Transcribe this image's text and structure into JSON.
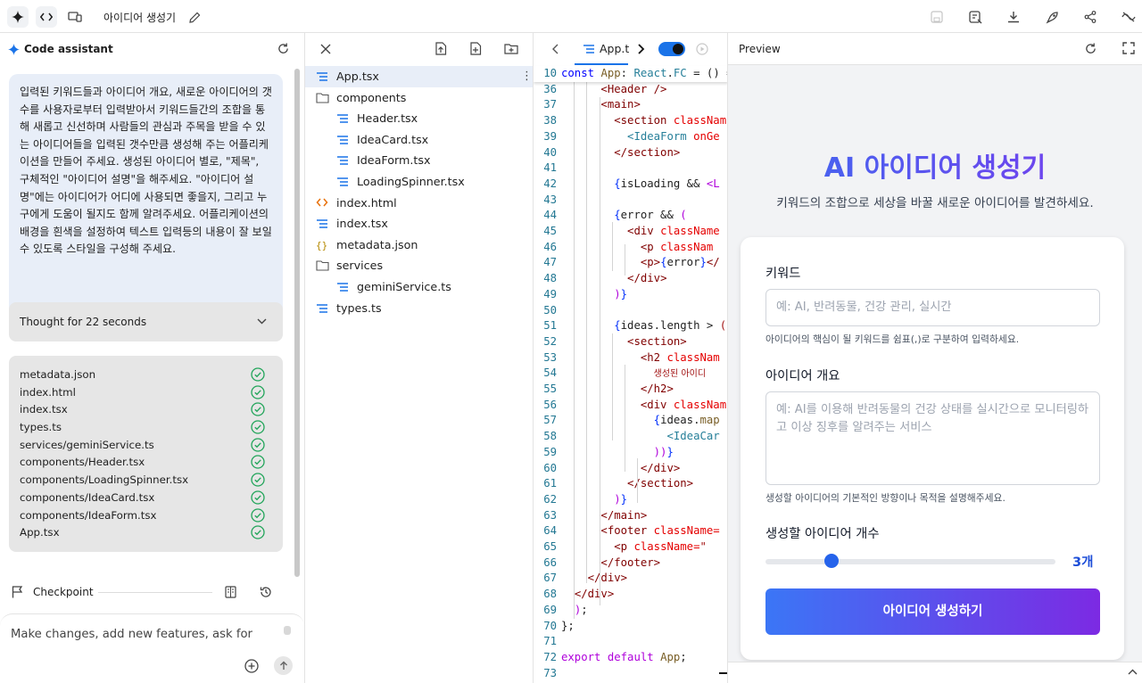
{
  "topbar": {
    "project_title": "아이디어 생성기"
  },
  "chat": {
    "title": "Code assistant",
    "prompt": "입력된 키워드들과 아이디어 개요, 새로운 아이디어의 갯수를 사용자로부터 입력받아서 키워드들간의 조합을 통해 새롭고 신선하며 사람들의 관심과 주목을 받을 수 있는 아이디어들을 입력된 갯수만큼 생성해 주는 어플리케이션을 만들어 주세요. 생성된 아이디어 별로, \"제목\", 구체적인 \"아이디어 설명\"을 해주세요. \"아이디어 설명\"에는 아이디어가 어디에 사용되면 좋을지, 그리고 누구에게 도움이 될지도 함께 알려주세요. 어플리케이션의 배경을 흰색을 설정하여 텍스트 입력등의 내용이 잘 보일 수 있도록 스타일을 구성해 주세요.",
    "thought": "Thought for 22 seconds",
    "files": [
      "metadata.json",
      "index.html",
      "index.tsx",
      "types.ts",
      "services/geminiService.ts",
      "components/Header.tsx",
      "components/LoadingSpinner.tsx",
      "components/IdeaCard.tsx",
      "components/IdeaForm.tsx",
      "App.tsx"
    ],
    "checkpoint": "Checkpoint",
    "input_placeholder": "Make changes, add new features, ask for"
  },
  "tree": {
    "items": [
      {
        "name": "App.tsx",
        "kind": "tsx",
        "indent": 0,
        "selected": true
      },
      {
        "name": "components",
        "kind": "folder",
        "indent": 0
      },
      {
        "name": "Header.tsx",
        "kind": "tsx",
        "indent": 1
      },
      {
        "name": "IdeaCard.tsx",
        "kind": "tsx",
        "indent": 1
      },
      {
        "name": "IdeaForm.tsx",
        "kind": "tsx",
        "indent": 1
      },
      {
        "name": "LoadingSpinner.tsx",
        "kind": "tsx",
        "indent": 1
      },
      {
        "name": "index.html",
        "kind": "html",
        "indent": 0
      },
      {
        "name": "index.tsx",
        "kind": "tsx",
        "indent": 0
      },
      {
        "name": "metadata.json",
        "kind": "json",
        "indent": 0
      },
      {
        "name": "services",
        "kind": "folder",
        "indent": 0
      },
      {
        "name": "geminiService.ts",
        "kind": "tsx",
        "indent": 1
      },
      {
        "name": "types.ts",
        "kind": "tsx",
        "indent": 0
      }
    ]
  },
  "editor": {
    "tab": "App.t",
    "sticky_line": {
      "n": "10",
      "html": "<span class=\"k\">const</span> <span class=\"f\">App</span>: <span class=\"v\">React</span>.<span class=\"v\">FC</span> = () <span class=\"pl\">=&gt;</span>"
    },
    "lines": [
      {
        "n": "36",
        "html": "      <span class=\"t\">&lt;Header</span> <span class=\"t\">/&gt;</span>"
      },
      {
        "n": "37",
        "html": "      <span class=\"t\">&lt;main&gt;</span>"
      },
      {
        "n": "38",
        "html": "        <span class=\"t\">&lt;section</span> <span class=\"a\">classNam</span>"
      },
      {
        "n": "39",
        "html": "          <span class=\"v\">&lt;IdeaForm</span> <span class=\"a\">onGe</span>"
      },
      {
        "n": "40",
        "html": "        <span class=\"t\">&lt;/section&gt;</span>"
      },
      {
        "n": "41",
        "html": ""
      },
      {
        "n": "42",
        "html": "        <span class=\"b\">{</span>isLoading &amp;&amp; <span class=\"kw\">&lt;L</span>"
      },
      {
        "n": "43",
        "html": ""
      },
      {
        "n": "44",
        "html": "        <span class=\"b\">{</span>error &amp;&amp; <span class=\"kw\">(</span>"
      },
      {
        "n": "45",
        "html": "          <span class=\"t\">&lt;div</span> <span class=\"a\">className</span>"
      },
      {
        "n": "46",
        "html": "            <span class=\"t\">&lt;p</span> <span class=\"a\">classNam</span>"
      },
      {
        "n": "47",
        "html": "            <span class=\"t\">&lt;p&gt;</span><span class=\"b\">{</span>error<span class=\"b\">}</span><span class=\"t\">&lt;/</span>"
      },
      {
        "n": "48",
        "html": "          <span class=\"t\">&lt;/div&gt;</span>"
      },
      {
        "n": "49",
        "html": "        <span class=\"kw\">)</span><span class=\"b\">}</span>"
      },
      {
        "n": "50",
        "html": ""
      },
      {
        "n": "51",
        "html": "        <span class=\"b\">{</span>ideas.length &gt; <span class=\"s\">(</span>"
      },
      {
        "n": "52",
        "html": "          <span class=\"t\">&lt;section&gt;</span>"
      },
      {
        "n": "53",
        "html": "            <span class=\"t\">&lt;h2</span> <span class=\"a\">classNam</span>"
      },
      {
        "n": "54",
        "html": "              <span class=\"s\" style=\"font-family:'DejaVu Sans',sans-serif;font-size:10px\">생성된 아이디</span>"
      },
      {
        "n": "55",
        "html": "            <span class=\"t\">&lt;/h2&gt;</span>"
      },
      {
        "n": "56",
        "html": "            <span class=\"t\">&lt;div</span> <span class=\"a\">classNam</span>"
      },
      {
        "n": "57",
        "html": "              <span class=\"b\">{</span>ideas.<span class=\"f\">map</span>"
      },
      {
        "n": "58",
        "html": "                <span class=\"v\">&lt;IdeaCar</span>"
      },
      {
        "n": "59",
        "html": "              <span class=\"kw\">))</span><span class=\"b\">}</span>"
      },
      {
        "n": "60",
        "html": "            <span class=\"t\">&lt;/div&gt;</span>"
      },
      {
        "n": "61",
        "html": "          <span class=\"t\">&lt;/section&gt;</span>"
      },
      {
        "n": "62",
        "html": "        <span class=\"kw\">)</span><span class=\"b\">}</span>"
      },
      {
        "n": "63",
        "html": "      <span class=\"t\">&lt;/main&gt;</span>"
      },
      {
        "n": "64",
        "html": "      <span class=\"t\">&lt;footer</span> <span class=\"a\">className=</span>"
      },
      {
        "n": "65",
        "html": "        <span class=\"t\">&lt;p</span> <span class=\"a\">className=</span><span class=\"s\">\"</span>"
      },
      {
        "n": "66",
        "html": "      <span class=\"t\">&lt;/footer&gt;</span>"
      },
      {
        "n": "67",
        "html": "    <span class=\"t\">&lt;/div&gt;</span>"
      },
      {
        "n": "68",
        "html": "  <span class=\"t\">&lt;/div&gt;</span>"
      },
      {
        "n": "69",
        "html": "  <span class=\"kw\">)</span>;"
      },
      {
        "n": "70",
        "html": "};"
      },
      {
        "n": "71",
        "html": ""
      },
      {
        "n": "72",
        "html": "<span class=\"kw\">export</span> <span class=\"kw\">default</span> <span class=\"f\">App</span>;"
      },
      {
        "n": "73",
        "html": ""
      }
    ]
  },
  "preview": {
    "label": "Preview",
    "app_title": "AI 아이디어 생성기",
    "app_subtitle": "키워드의 조합으로 세상을 바꿀 새로운 아이디어를 발견하세요.",
    "keyword_label": "키워드",
    "keyword_placeholder": "예: AI, 반려동물, 건강 관리, 실시간",
    "keyword_help": "아이디어의 핵심이 될 키워드를 쉼표(,)로 구분하여 입력하세요.",
    "overview_label": "아이디어 개요",
    "overview_placeholder": "예: AI를 이용해 반려동물의 건강 상태를 실시간으로 모니터링하고 이상 징후를 알려주는 서비스",
    "overview_help": "생성할 아이디어의 기본적인 방향이나 목적을 설명해주세요.",
    "count_label": "생성할 아이디어 개수",
    "count_value": "3개",
    "count_fraction": 0.2,
    "generate_label": "아이디어 생성하기"
  }
}
